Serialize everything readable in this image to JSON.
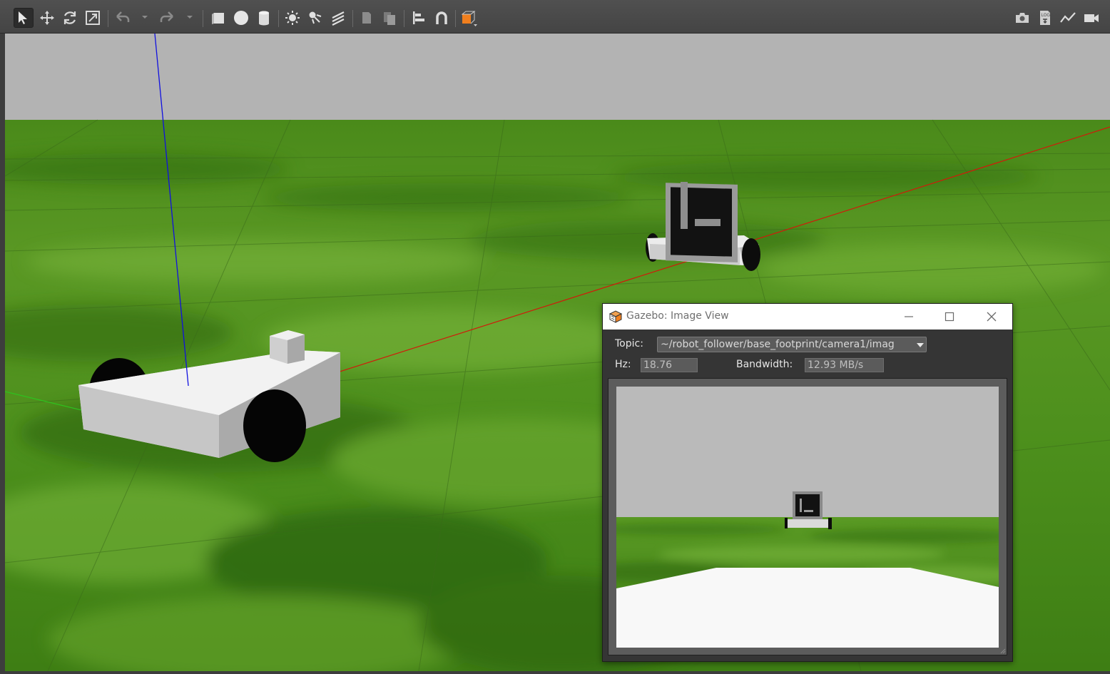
{
  "toolbar": {
    "left_tools": [
      {
        "name": "select-mode-icon",
        "active": true
      },
      {
        "name": "translate-mode-icon"
      },
      {
        "name": "rotate-mode-icon"
      },
      {
        "name": "scale-mode-icon"
      },
      {
        "name": "undo-icon"
      },
      {
        "name": "redo-icon"
      },
      {
        "name": "box-shape-icon"
      },
      {
        "name": "sphere-shape-icon"
      },
      {
        "name": "cylinder-shape-icon"
      },
      {
        "name": "point-light-icon"
      },
      {
        "name": "spot-light-icon"
      },
      {
        "name": "directional-light-icon"
      },
      {
        "name": "copy-icon"
      },
      {
        "name": "paste-icon"
      },
      {
        "name": "align-icon"
      },
      {
        "name": "snap-magnet-icon"
      },
      {
        "name": "view-angle-icon"
      }
    ],
    "right_tools": [
      {
        "name": "screenshot-icon"
      },
      {
        "name": "log-icon"
      },
      {
        "name": "plot-icon"
      },
      {
        "name": "video-record-icon"
      }
    ],
    "accent_color": "#f07f1e"
  },
  "scene": {
    "sky_color": "#b3b3b3",
    "ground_color": "#3f7d14",
    "axis_colors": {
      "x": "#d11a0a",
      "y": "#2ec21e",
      "z": "#1010e0"
    }
  },
  "image_view": {
    "title": "Gazebo: Image View",
    "topic_label": "Topic:",
    "topic_value": "~/robot_follower/base_footprint/camera1/imag",
    "hz_label": "Hz:",
    "hz_value": "18.76",
    "bandwidth_label": "Bandwidth:",
    "bandwidth_value": "12.93 MB/s"
  }
}
